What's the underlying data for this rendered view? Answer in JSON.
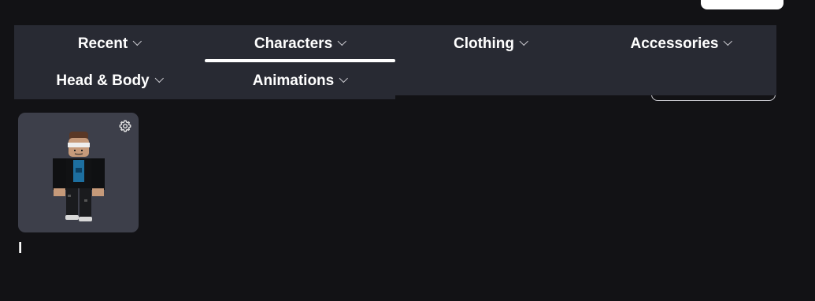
{
  "nav": {
    "row1": [
      {
        "label": "Recent"
      },
      {
        "label": "Characters"
      },
      {
        "label": "Clothing"
      },
      {
        "label": "Accessories"
      }
    ],
    "row2": [
      {
        "label": "Head & Body"
      },
      {
        "label": "Animations"
      }
    ],
    "active": "Characters",
    "chevron_icon": "chevron-down-icon"
  },
  "items": [
    {
      "name": "l",
      "settings_icon": "gear-icon"
    }
  ],
  "colors": {
    "background": "#121215",
    "nav_background": "#282a33",
    "tile_background": "#3d3f4a",
    "active_underline": "#ffffff"
  }
}
